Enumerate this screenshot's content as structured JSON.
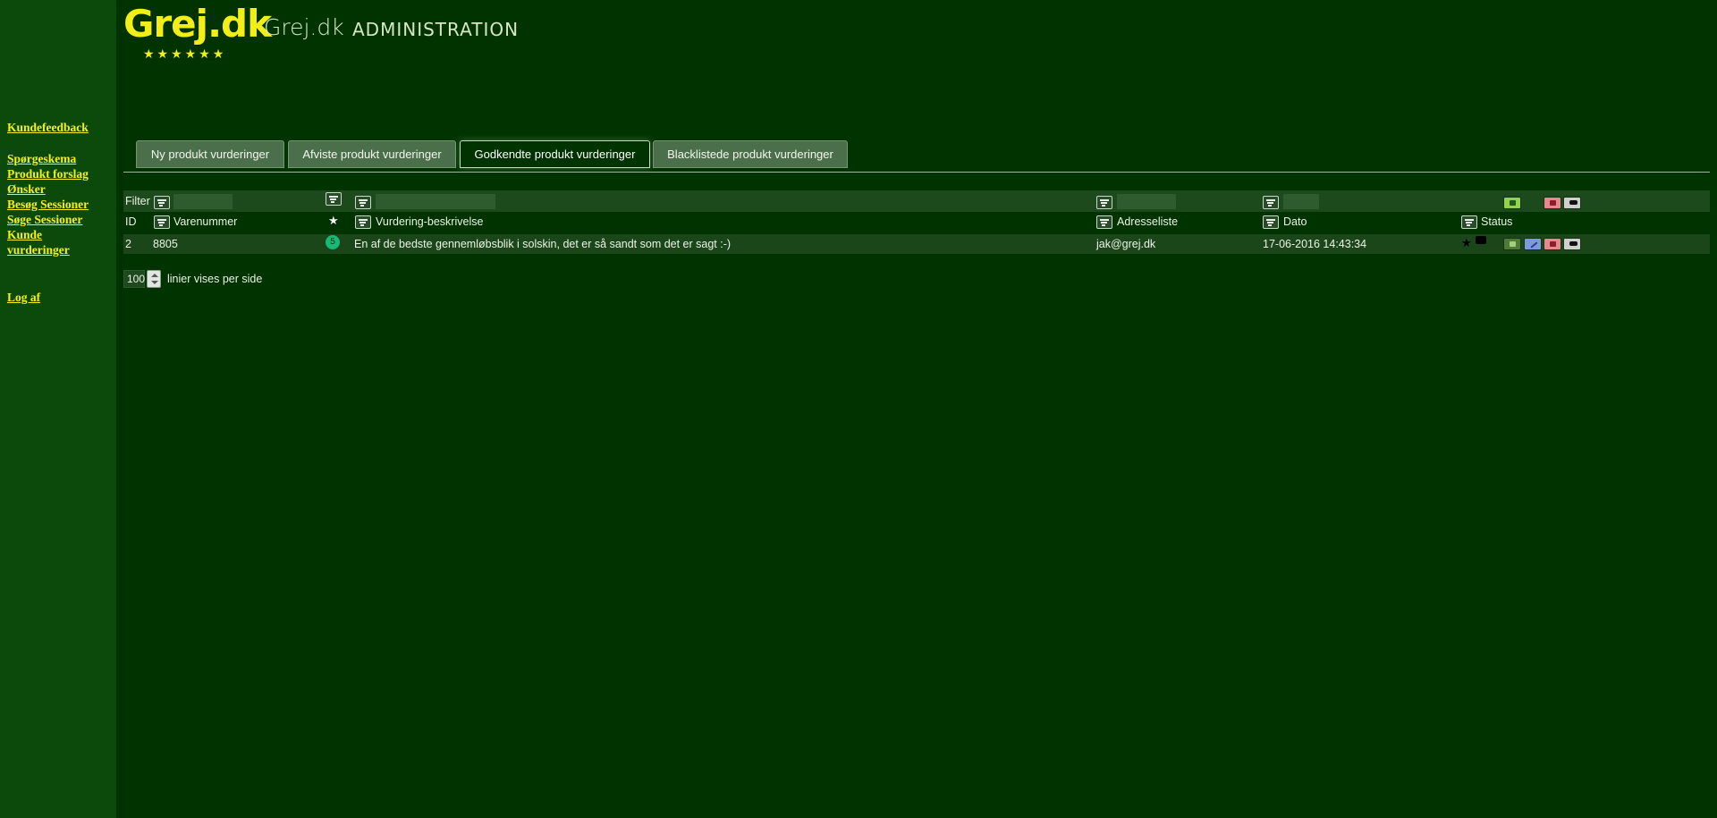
{
  "header": {
    "logo_text": "Grej.dk",
    "logo_stars": "★★★★★★",
    "site_name": "Grej.dk",
    "section_title": "ADMINISTRATION"
  },
  "sidebar": {
    "items": [
      {
        "label": "Kundefeedback"
      },
      {
        "label": "Spørgeskema"
      },
      {
        "label": "Produkt forslag"
      },
      {
        "label": "Ønsker"
      },
      {
        "label": "Besøg Sessioner"
      },
      {
        "label": "Søge Sessioner"
      },
      {
        "label": "Kunde vurderinger"
      },
      {
        "label": "Log af"
      }
    ]
  },
  "tabs": [
    {
      "label": "Ny produkt vurderinger",
      "active": false
    },
    {
      "label": "Afviste produkt vurderinger",
      "active": false
    },
    {
      "label": "Godkendte produkt vurderinger",
      "active": true
    },
    {
      "label": "Blacklistede produkt vurderinger",
      "active": false
    }
  ],
  "grid": {
    "filter_label": "Filter",
    "star_symbol": "★",
    "columns": {
      "id": "ID",
      "varenummer": "Varenummer",
      "beskrivelse": "Vurdering-beskrivelse",
      "adresseliste": "Adresseliste",
      "dato": "Dato",
      "status": "Status"
    },
    "rows": [
      {
        "id": "2",
        "varenummer": "8805",
        "rating": "5",
        "beskrivelse": "En af de bedste gennemløbsblik i solskin, det er så sandt som det er sagt :-)",
        "adresseliste": "jak@grej.dk",
        "dato": "17-06-2016 14:43:34"
      }
    ],
    "colors": {
      "approve": "#92d34a",
      "edit": "#7b9ae0",
      "reject": "#e8888e",
      "blacklist": "#cfcfcf"
    }
  },
  "pager": {
    "page_size": "100",
    "label": "linier vises per side"
  },
  "icons": [
    "logo-stars",
    "sort-icon",
    "star-icon",
    "comment-icon",
    "thumbs-up-icon",
    "thumbs-down-icon",
    "edit-icon",
    "blacklist-icon",
    "spinner-icon"
  ]
}
